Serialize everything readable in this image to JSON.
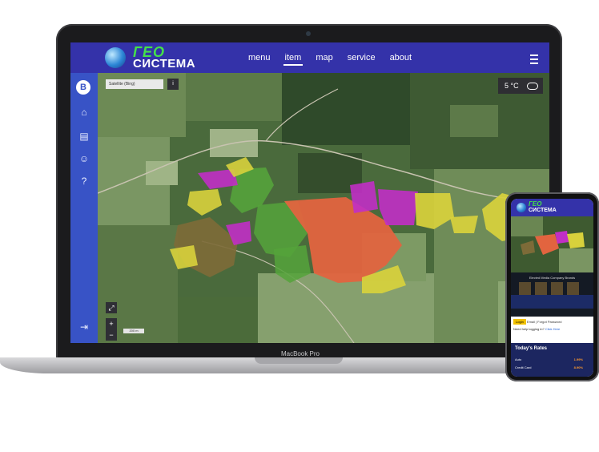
{
  "laptop": {
    "label": "MacBook Pro",
    "app": {
      "logo": {
        "line1": "ГЕО",
        "line2": "СИСТЕМА"
      },
      "nav": [
        {
          "label": "menu"
        },
        {
          "label": "item",
          "active": true
        },
        {
          "label": "map"
        },
        {
          "label": "service"
        },
        {
          "label": "about"
        }
      ],
      "sidebar": {
        "brand": "B"
      },
      "map": {
        "layer_select": "Satellite (Bing)",
        "info_button": "i",
        "weather": "5 °C",
        "zoom_in": "+",
        "zoom_out": "−",
        "scale": "200 m"
      }
    }
  },
  "phone": {
    "logo": {
      "line1": "ГЕО",
      "line2": "СИСТЕМА"
    },
    "section_title": "Elected Media Company Brands",
    "login_button": "Login",
    "login_text": "Email | Forgot Password",
    "help_text": "Need help logging in?",
    "help_link": "Click Here",
    "rates_title": "Today's Rates",
    "rates": [
      {
        "label": "Auto",
        "value": "1.99%"
      },
      {
        "label": "Credit Card",
        "value": "8.90%"
      }
    ]
  },
  "colors": {
    "header": "#3432a9",
    "sidebar": "#3853c6",
    "logo_green": "#45e04a",
    "field_orange": "#e2643f",
    "field_yellow": "#d8d13c",
    "field_magenta": "#c12fc5",
    "field_green": "#55a33b",
    "field_brown": "#7d6b38"
  }
}
